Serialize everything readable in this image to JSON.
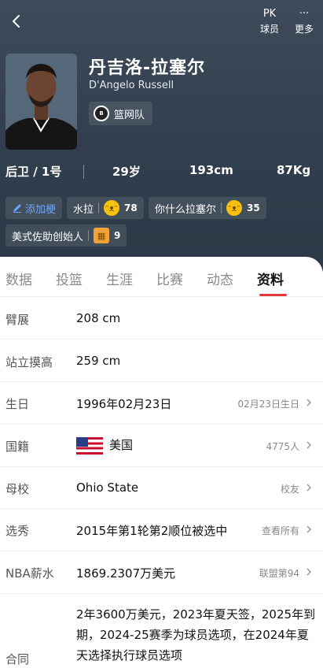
{
  "top": {
    "pk_icon": "PK",
    "pk_label": "球员",
    "more_icon": "···",
    "more_label": "更多"
  },
  "player": {
    "name_cn": "丹吉洛-拉塞尔",
    "name_en": "D'Angelo Russell",
    "team": "篮网队",
    "position": "后卫 / 1号",
    "age": "29岁",
    "height": "193cm",
    "weight": "87Kg"
  },
  "tags": {
    "add_label": "添加梗",
    "items": [
      {
        "text": "水拉",
        "count": "78"
      },
      {
        "text": "你什么拉塞尔",
        "count": "35"
      },
      {
        "text": "美式佐助创始人",
        "count": "9"
      }
    ]
  },
  "tabs": [
    "数据",
    "投篮",
    "生涯",
    "比赛",
    "动态",
    "资料"
  ],
  "active_tab": "资料",
  "info": {
    "wingspan": {
      "label": "臂展",
      "value": "208 cm"
    },
    "reach": {
      "label": "站立摸高",
      "value": "259 cm"
    },
    "birthday": {
      "label": "生日",
      "value": "1996年02月23日",
      "right": "02月23日生日"
    },
    "nationality": {
      "label": "国籍",
      "value": "美国",
      "right": "4775人"
    },
    "school": {
      "label": "母校",
      "value": "Ohio State",
      "right": "校友"
    },
    "draft": {
      "label": "选秀",
      "value": "2015年第1轮第2顺位被选中",
      "right": "查看所有"
    },
    "salary": {
      "label": "NBA薪水",
      "value": "1869.2307万美元",
      "right": "联盟第94"
    },
    "contract": {
      "label": "合同",
      "value": "2年3600万美元，2023年夏天签，2025年到期，2024-25赛季为球员选项，在2024年夏天选择执行球员选项"
    }
  },
  "colors": {
    "accent": "#e4393c",
    "header_bg": "#36424f",
    "link": "#6aa7ff"
  }
}
